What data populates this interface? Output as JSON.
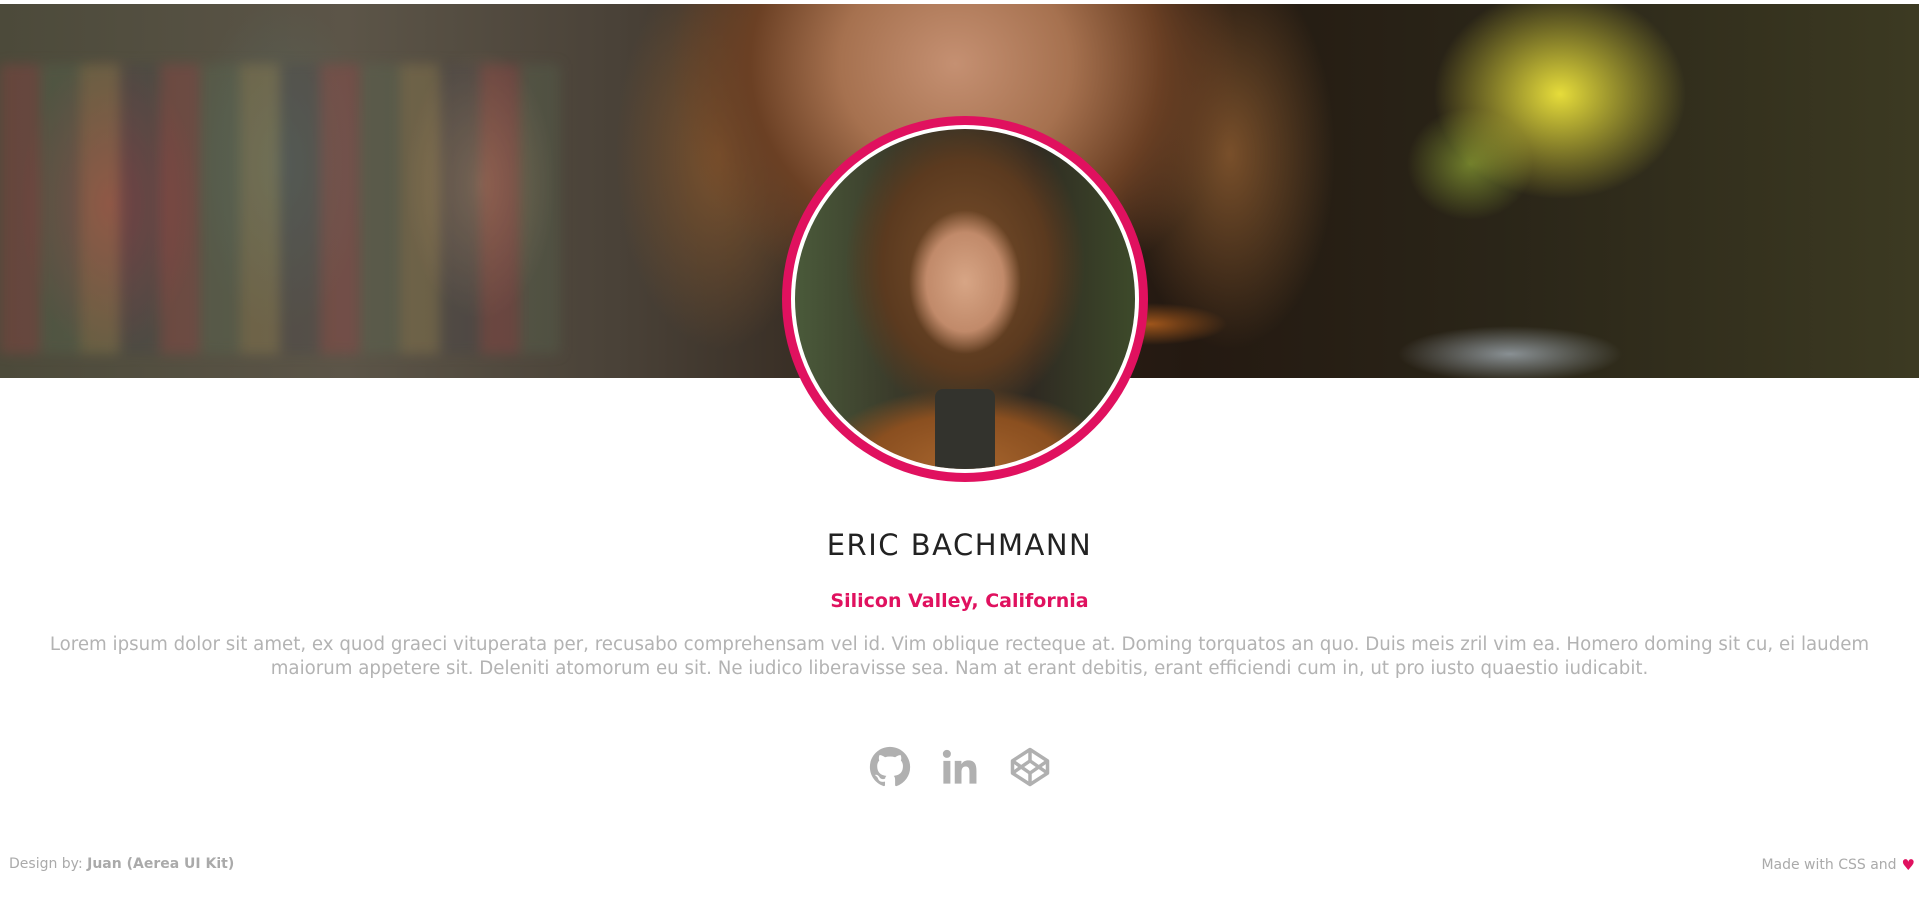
{
  "profile": {
    "name": "ERIC BACHMANN",
    "location": "Silicon Valley, California",
    "bio": "Lorem ipsum dolor sit amet, ex quod graeci vituperata per, recusabo comprehensam vel id. Vim oblique recteque at. Doming torquatos an quo. Duis meis zril vim ea. Homero doming sit cu, ei laudem maiorum appetere sit. Deleniti atomorum eu sit. Ne iudico liberavisse sea. Nam at erant debitis, erant efficiendi cum in, ut pro iusto quaestio iudicabit."
  },
  "social": [
    {
      "name": "github",
      "icon": "github-icon"
    },
    {
      "name": "linkedin",
      "icon": "linkedin-icon"
    },
    {
      "name": "codepen",
      "icon": "codepen-icon"
    }
  ],
  "footer": {
    "left_prefix": "Design by:",
    "left_author": "Juan (Aerea UI Kit)",
    "right_text": "Made with CSS and",
    "right_icon": "heart-icon"
  },
  "colors": {
    "accent": "#e0115f",
    "muted_text": "#b3b3b3",
    "icon_gray": "#b0b0b0",
    "name_text": "#222222"
  }
}
